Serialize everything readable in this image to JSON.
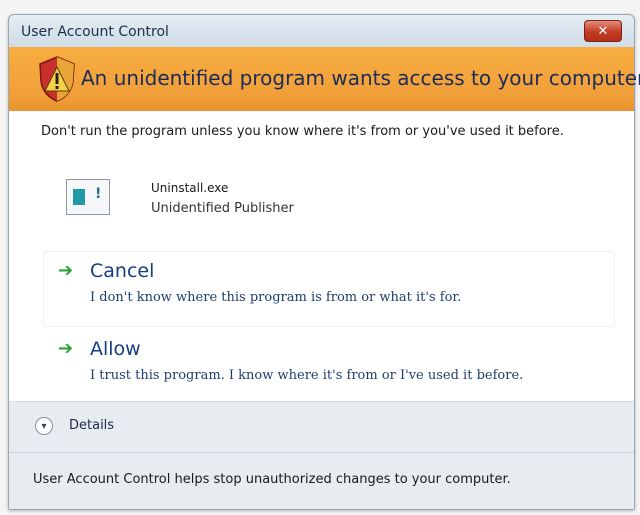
{
  "window": {
    "title": "User Account Control",
    "close_label": "✕"
  },
  "banner": {
    "text": "An unidentified program wants access to your computer",
    "icon": "shield-warning-icon",
    "color": "#f1a03a"
  },
  "message": "Don't run the program unless you know where it's from or you've used it before.",
  "program": {
    "name": "Uninstall.exe",
    "publisher": "Unidentified Publisher",
    "icon": "program-icon"
  },
  "options": [
    {
      "title": "Cancel",
      "description": "I don't know where this program is from or what it's for.",
      "icon": "green-arrow-icon"
    },
    {
      "title": "Allow",
      "description": "I trust this program. I know where it's from or I've used it before.",
      "icon": "green-arrow-icon"
    }
  ],
  "details": {
    "label": "Details",
    "icon": "chevron-down-icon"
  },
  "footer": "User Account Control helps stop unauthorized changes to your computer."
}
